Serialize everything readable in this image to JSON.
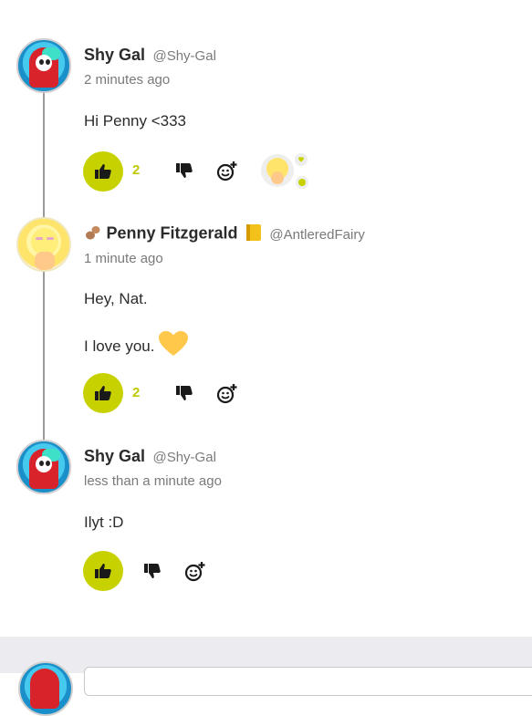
{
  "colors": {
    "accent": "#c8d100",
    "count": "#c0c800",
    "thread_line": "#9a9a9a",
    "footer_bg": "#ebebf0"
  },
  "posts": [
    {
      "author": "Shy Gal",
      "handle": "@Shy-Gal",
      "time": "2 minutes ago",
      "lines": [
        "Hi Penny <333"
      ],
      "likes": "2",
      "icons": [
        "thumbs-up-icon",
        "thumbs-down-icon",
        "add-emoji-icon"
      ]
    },
    {
      "author": "Penny Fitzgerald",
      "handle": "@AntleredFairy",
      "time": "1 minute ago",
      "lines": [
        "Hey, Nat.",
        "I love you."
      ],
      "likes": "2",
      "icons": [
        "peanut-icon",
        "notebook-icon",
        "yellow-heart-icon",
        "thumbs-up-icon",
        "thumbs-down-icon",
        "add-emoji-icon"
      ]
    },
    {
      "author": "Shy Gal",
      "handle": "@Shy-Gal",
      "time": "less than a minute ago",
      "lines": [
        "Ilyt :D"
      ],
      "likes": "",
      "icons": [
        "thumbs-up-icon",
        "thumbs-down-icon",
        "add-emoji-icon"
      ]
    }
  ]
}
